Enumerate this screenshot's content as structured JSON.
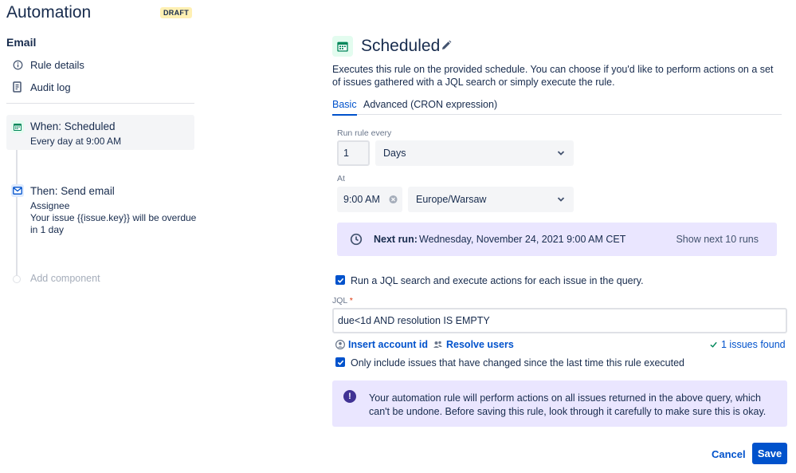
{
  "app": {
    "title": "Automation",
    "badge": "DRAFT"
  },
  "sidebar": {
    "rule_name": "Email",
    "nav": [
      {
        "label": "Rule details",
        "icon": "info-icon"
      },
      {
        "label": "Audit log",
        "icon": "document-icon"
      }
    ],
    "components": {
      "trigger": {
        "title": "When: Scheduled",
        "subtitle": "Every day at 9:00 AM"
      },
      "action": {
        "title": "Then: Send email",
        "line1": "Assignee",
        "line2": "Your issue {{issue.key}} will be overdue",
        "line3": "in 1 day"
      },
      "add_label": "Add component"
    }
  },
  "main": {
    "title": "Scheduled",
    "description": "Executes this rule on the provided schedule. You can choose if you'd like to perform actions on a set of issues gathered with a JQL search or simply execute the rule.",
    "tabs": [
      {
        "label": "Basic",
        "active": true
      },
      {
        "label": "Advanced (CRON expression)",
        "active": false
      }
    ],
    "run_every": {
      "label": "Run rule every",
      "value": "1",
      "unit": "Days"
    },
    "at": {
      "label": "At",
      "time": "9:00 AM",
      "timezone": "Europe/Warsaw"
    },
    "next_run": {
      "label": "Next run:",
      "value": "Wednesday, November 24, 2021 9:00 AM CET",
      "link": "Show next 10 runs"
    },
    "jql_checkbox": {
      "label": "Run a JQL search and execute actions for each issue in the query.",
      "checked": true
    },
    "jql": {
      "label": "JQL",
      "required_mark": "*",
      "value": "due<1d AND resolution IS EMPTY"
    },
    "links": {
      "insert": "Insert account id",
      "resolve": "Resolve users",
      "found": "1 issues found"
    },
    "changed_checkbox": {
      "label": "Only include issues that have changed since the last time this rule executed",
      "checked": true
    },
    "warning": "Your automation rule will perform actions on all issues returned in the above query, which can't be undone. Before saving this rule, look through it carefully to make sure this is okay.",
    "buttons": {
      "cancel": "Cancel",
      "save": "Save"
    }
  },
  "colors": {
    "primary": "#0052CC",
    "text": "#172B4D",
    "subtle": "#6B778C",
    "purple_bg": "#EAE6FF",
    "green_bg": "#E3FCEF",
    "green": "#00875A"
  }
}
